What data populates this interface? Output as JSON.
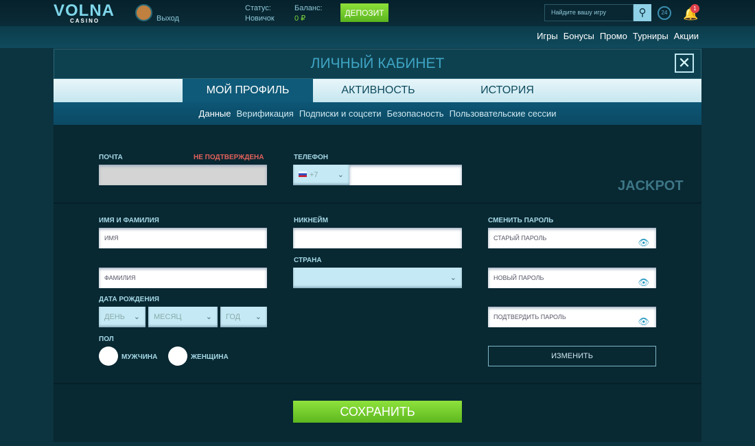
{
  "header": {
    "logo": "VOLNA",
    "logo_sub": "CASINO",
    "exit": "Выход",
    "status_label": "Статус:",
    "status_value": "Новичок",
    "balance_label": "Баланс:",
    "balance_value": "0 ₽",
    "deposit": "ДЕПОЗИТ",
    "search_placeholder": "Найдите вашу игру",
    "support": "24",
    "notifications": "1"
  },
  "nav": [
    "Игры",
    "Бонусы",
    "Промо",
    "Турниры",
    "Акции"
  ],
  "background": {
    "jackpot": "JACKPOT"
  },
  "modal": {
    "title": "ЛИЧНЫЙ КАБИНЕТ",
    "tabs": [
      "МОЙ ПРОФИЛЬ",
      "АКТИВНОСТЬ",
      "ИСТОРИЯ"
    ],
    "subtabs": [
      "Данные",
      "Верификация",
      "Подписки и соцсети",
      "Безопасность",
      "Пользовательские сессии"
    ],
    "form": {
      "email_label": "ПОЧТА",
      "email_status": "НЕ ПОДТВЕРЖДЕНА",
      "phone_label": "ТЕЛЕФОН",
      "phone_code": "+7",
      "name_label": "ИМЯ И ФАМИЛИЯ",
      "first_name_ph": "ИМЯ",
      "last_name_ph": "ФАМИЛИЯ",
      "nick_label": "НИКНЕЙМ",
      "country_label": "СТРАНА",
      "dob_label": "ДАТА РОЖДЕНИЯ",
      "day": "ДЕНЬ",
      "month": "МЕСЯЦ",
      "year": "ГОД",
      "gender_label": "ПОЛ",
      "male": "МУЖЧИНА",
      "female": "ЖЕНЩИНА",
      "pw_label": "СМЕНИТЬ ПАРОЛЬ",
      "old_pw": "СТАРЫЙ ПАРОЛЬ",
      "new_pw": "НОВЫЙ ПАРОЛЬ",
      "confirm_pw": "ПОДТВЕРДИТЬ ПАРОЛЬ",
      "change": "ИЗМЕНИТЬ",
      "save": "СОХРАНИТЬ"
    }
  },
  "colors": {
    "accent_green": "#6cc624",
    "error": "#e0605a",
    "tab_active": "#0f5a78"
  }
}
